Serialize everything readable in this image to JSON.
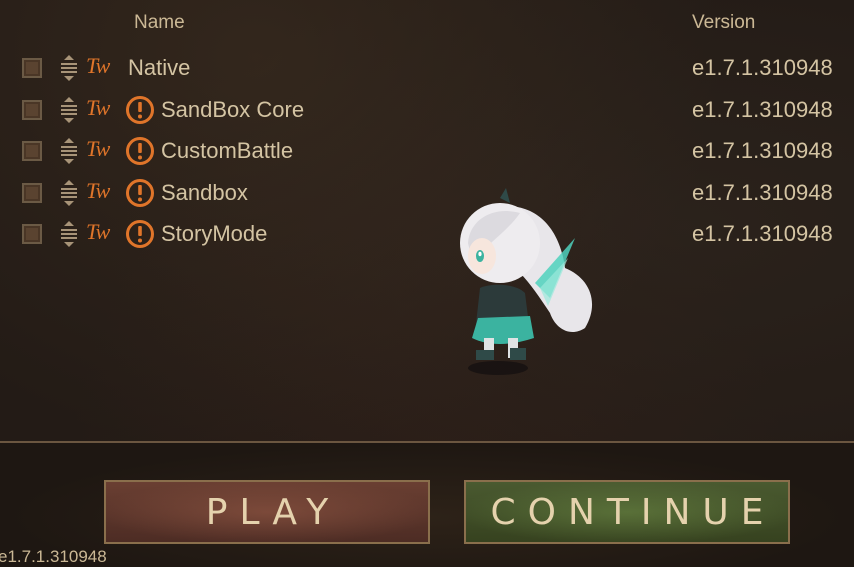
{
  "header": {
    "name_label": "Name",
    "version_label": "Version"
  },
  "mods": [
    {
      "name": "Native",
      "version": "e1.7.1.310948",
      "warning": false,
      "checked": false
    },
    {
      "name": "SandBox Core",
      "version": "e1.7.1.310948",
      "warning": true,
      "checked": false
    },
    {
      "name": "CustomBattle",
      "version": "e1.7.1.310948",
      "warning": true,
      "checked": false
    },
    {
      "name": "Sandbox",
      "version": "e1.7.1.310948",
      "warning": true,
      "checked": false
    },
    {
      "name": "StoryMode",
      "version": "e1.7.1.310948",
      "warning": true,
      "checked": false
    }
  ],
  "icons": {
    "tw_logo_text": "Tw",
    "drag": "drag-handle-icon",
    "warning": "warning-icon"
  },
  "buttons": {
    "play_label": "PLAY",
    "continue_label": "CONTINUE"
  },
  "footer": {
    "game_version": "e1.7.1.310948"
  },
  "colors": {
    "accent_orange": "#e0752a",
    "text": "#d4c4a3",
    "play_bg": "#5a3429",
    "continue_bg": "#414f27"
  }
}
